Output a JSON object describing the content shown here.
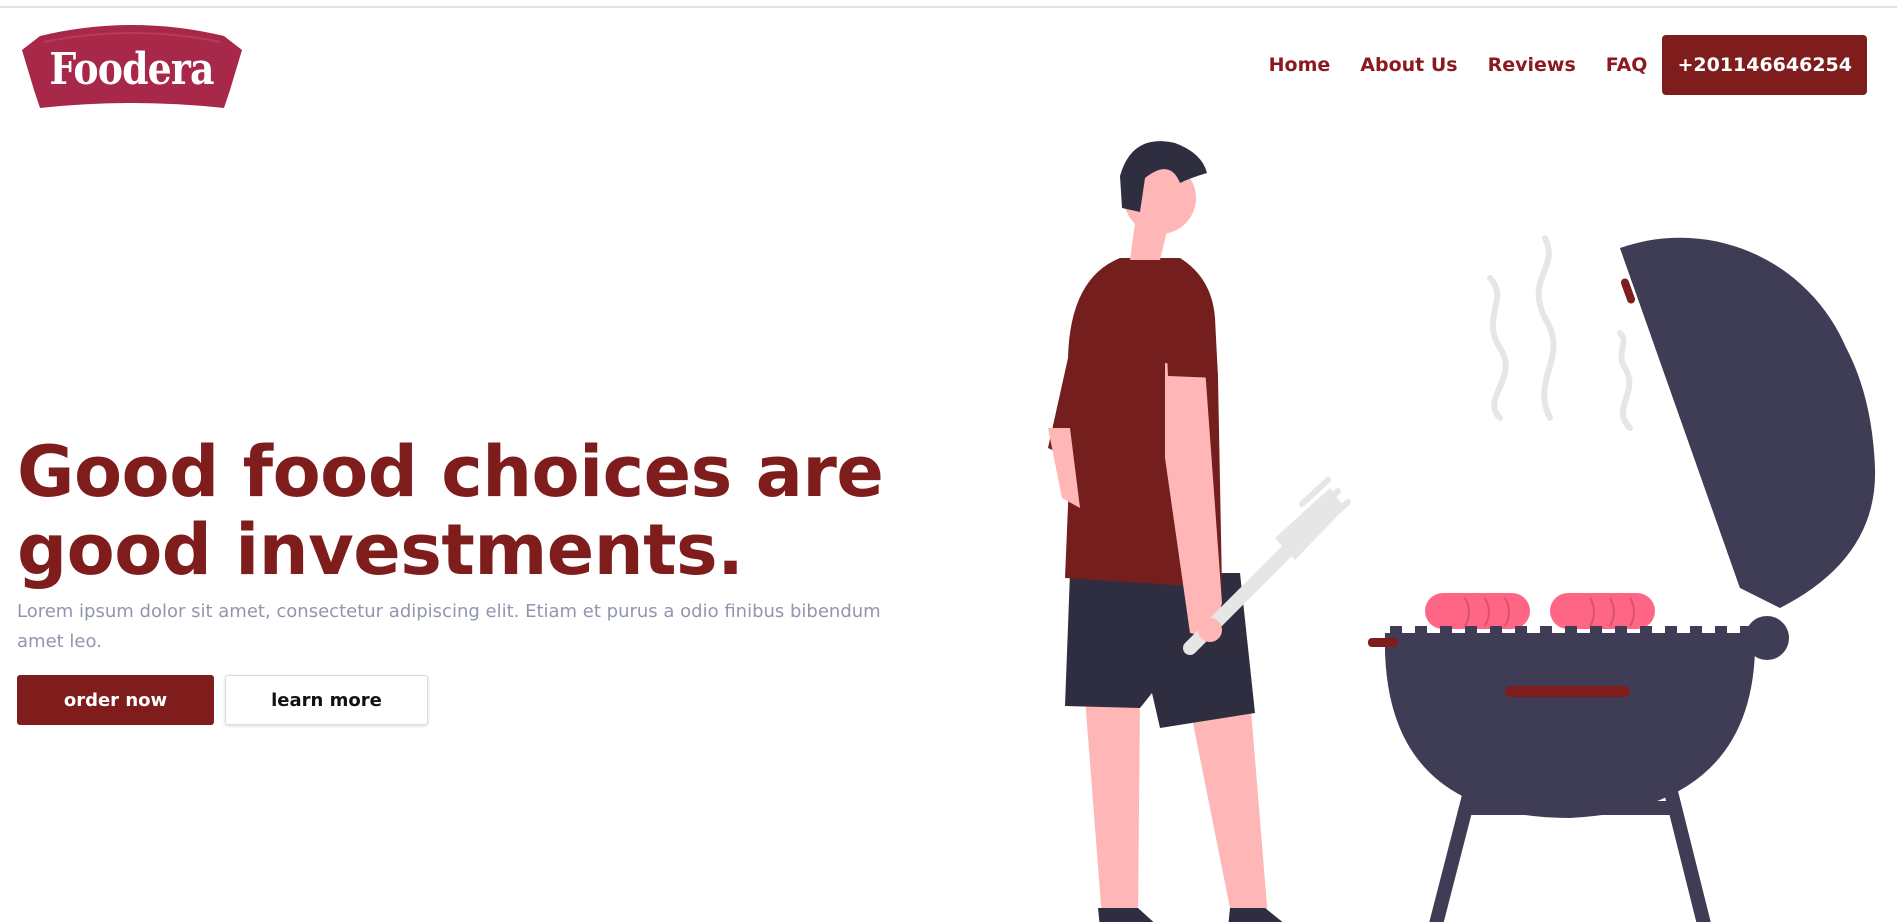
{
  "brand": {
    "name": "Foodera"
  },
  "nav": {
    "items": [
      {
        "label": "Home"
      },
      {
        "label": "About Us"
      },
      {
        "label": "Reviews"
      },
      {
        "label": "FAQ"
      }
    ],
    "phone": "+201146646254"
  },
  "hero": {
    "headline_line1": "Good food choices are",
    "headline_line2": "good investments.",
    "subtext": "Lorem ipsum dolor sit amet, consectetur adipiscing elit. Etiam et purus a odio finibus bibendum amet leo.",
    "primary_cta": "order now",
    "secondary_cta": "learn more"
  },
  "colors": {
    "brand_red": "#7f1d1d",
    "logo_red": "#a8284a",
    "text_muted": "#9196ad",
    "grill_dark": "#3f3d56",
    "skin": "#ffb6b6",
    "sausage": "#ff6584"
  },
  "icons": {
    "illustration": "man-grilling-illustration"
  }
}
